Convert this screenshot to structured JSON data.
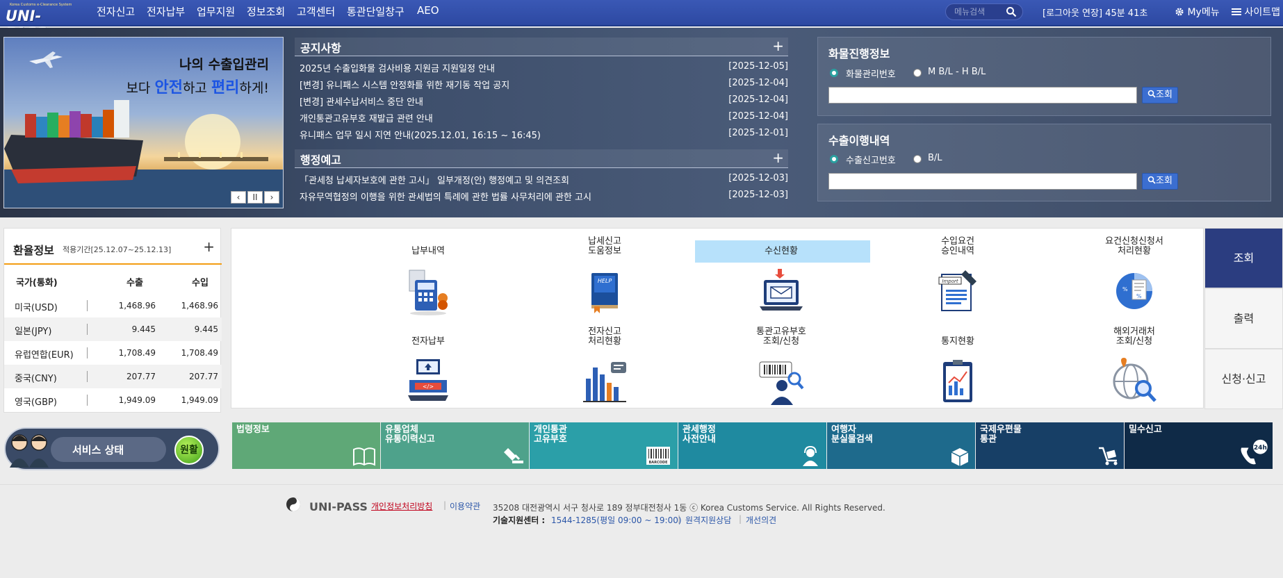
{
  "header": {
    "logo_tagline": "Korea Customs e-Clearance System",
    "logo_text": "UNI-PASS",
    "nav": [
      "전자신고",
      "전자납부",
      "업무지원",
      "정보조회",
      "고객센터",
      "통관단일창구",
      "AEO"
    ],
    "search_placeholder": "메뉴검색",
    "session_timer": "[로그아웃 연장] 45분 41초",
    "my_menu": "My메뉴",
    "sitemap": "사이트맵"
  },
  "banner": {
    "line1": "나의 수출입관리",
    "line2_prefix": "보다 ",
    "line2_hl1": "안전",
    "line2_mid": "하고 ",
    "line2_hl2": "편리",
    "line2_suffix": "하게!",
    "prev": "‹",
    "pause": "II",
    "next": "›"
  },
  "notices": {
    "title": "공지사항",
    "more": "+",
    "items": [
      {
        "text": "2025년 수출입화물 검사비용 지원금 지원일정 안내",
        "date": "[2025-12-05]"
      },
      {
        "text": "[변경] 유니패스 시스템 안정화를 위한 재기동 작업 공지",
        "date": "[2025-12-04]"
      },
      {
        "text": "[변경] 관세수납서비스 중단 안내",
        "date": "[2025-12-04]"
      },
      {
        "text": "개인통관고유부호 재발급 관련 안내",
        "date": "[2025-12-04]"
      },
      {
        "text": "유니패스 업무 일시 지연 안내(2025.12.01, 16:15 ~ 16:45)",
        "date": "[2025-12-01]"
      }
    ]
  },
  "admin_notices": {
    "title": "행정예고",
    "more": "+",
    "items": [
      {
        "text": "「관세청 납세자보호에 관한 고시」 일부개정(안) 행정예고 및 의견조회",
        "date": "[2025-12-03]"
      },
      {
        "text": "자유무역협정의 이행을 위한 관세법의 특례에 관한 법률 사무처리에 관한 고시",
        "date": "[2025-12-03]"
      }
    ]
  },
  "cargo": {
    "title": "화물진행정보",
    "radio1": "화물관리번호",
    "radio2": "M B/L - H B/L",
    "button": "조회",
    "value": ""
  },
  "export": {
    "title": "수출이행내역",
    "radio1": "수출신고번호",
    "radio2": "B/L",
    "button": "조회",
    "value": ""
  },
  "exchange": {
    "title": "환율정보",
    "period": "적용기간[25.12.07~25.12.13]",
    "more": "+",
    "headers": [
      "국가(통화)",
      "수출",
      "수입"
    ],
    "rows": [
      {
        "country": "미국(USD)",
        "export": "1,468.96",
        "import": "1,468.96"
      },
      {
        "country": "일본(JPY)",
        "export": "9.445",
        "import": "9.445"
      },
      {
        "country": "유럽연합(EUR)",
        "export": "1,708.49",
        "import": "1,708.49"
      },
      {
        "country": "중국(CNY)",
        "export": "207.77",
        "import": "207.77"
      },
      {
        "country": "영국(GBP)",
        "export": "1,949.09",
        "import": "1,949.09"
      }
    ]
  },
  "service": {
    "label": "서비스 상태",
    "status": "원활"
  },
  "grid": {
    "items": [
      {
        "label": "납부내역",
        "icon": "payment-calculator-icon"
      },
      {
        "label": "납세신고\n도움정보",
        "icon": "help-book-icon"
      },
      {
        "label": "수신현황",
        "icon": "mail-laptop-icon",
        "selected": true
      },
      {
        "label": "수입요건\n승인내역",
        "icon": "import-document-icon"
      },
      {
        "label": "요건신청신청서\n처리현황",
        "icon": "pie-chart-document-icon"
      },
      {
        "label": "전자납부",
        "icon": "electronic-payment-icon"
      },
      {
        "label": "전자신고\n처리현황",
        "icon": "bar-chart-icon"
      },
      {
        "label": "통관고유부호\n조회/신청",
        "icon": "barcode-person-icon"
      },
      {
        "label": "통지현황",
        "icon": "clipboard-chart-icon"
      },
      {
        "label": "해외거래처\n조회/신청",
        "icon": "globe-search-icon"
      }
    ]
  },
  "side_tabs": [
    "조회",
    "출력",
    "신청·신고"
  ],
  "quick_links": [
    {
      "label": "법령정보",
      "color": "#5fa877",
      "icon": "open-book-icon"
    },
    {
      "label": "유통업체\n유통이력신고",
      "color": "#4ea28b",
      "icon": "stamp-icon"
    },
    {
      "label": "개인통관\n고유부호",
      "color": "#2b9fa8",
      "icon": "barcode-icon",
      "icon_text": "BARCODE"
    },
    {
      "label": "관세행정\n사전안내",
      "color": "#1f8aa0",
      "icon": "headset-agent-icon"
    },
    {
      "label": "여행자\n분실물검색",
      "color": "#1e6a8c",
      "icon": "lost-box-icon"
    },
    {
      "label": "국제우편물\n통관",
      "color": "#173f66",
      "icon": "cart-parcel-icon"
    },
    {
      "label": "밀수신고",
      "color": "#0f2a47",
      "icon": "phone-24h-icon",
      "icon_text": "24h"
    }
  ],
  "footer": {
    "brand": "UNI-PASS",
    "privacy": "개인정보처리방침",
    "terms": "이용약관",
    "address": "35208 대전광역시 서구 청사로 189 정부대전청사 1동 ⓒ Korea Customs Service. All Rights Reserved.",
    "support_label": "기술지원센터 : ",
    "support_phone": "1544-1285(평일 09:00 ~ 19:00)",
    "remote": "원격지원상담",
    "improve": "개선의견"
  }
}
